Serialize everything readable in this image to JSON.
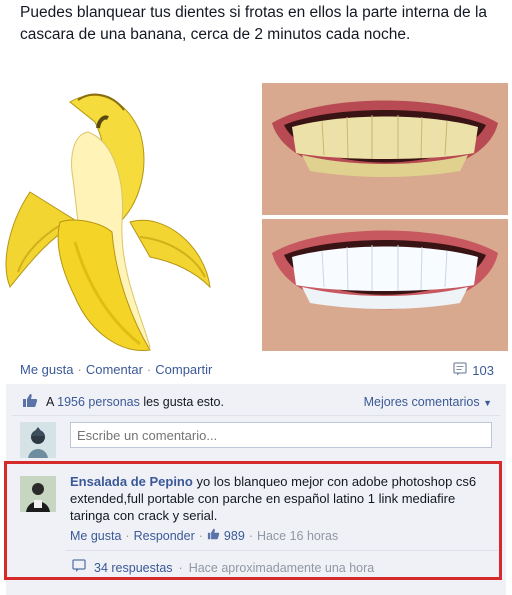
{
  "post": {
    "text": "Puedes blanquear tus dientes si frotas en ellos la parte interna de la cascara de una banana, cerca de 2 minutos cada noche."
  },
  "actions": {
    "like": "Me gusta",
    "comment": "Comentar",
    "share": "Compartir",
    "comment_count": "103"
  },
  "likes": {
    "prefix": "A",
    "people": "1956 personas",
    "suffix": "les gusta esto.",
    "sort_label": "Mejores comentarios"
  },
  "comment_input": {
    "placeholder": "Escribe un comentario..."
  },
  "top_comment": {
    "author": "Ensalada de Pepino",
    "text": "yo los blanqueo mejor con adobe photoshop cs6 extended,full portable con parche en español latino 1 link mediafire taringa con crack y serial.",
    "like_label": "Me gusta",
    "reply_label": "Responder",
    "like_count": "989",
    "time": "Hace 16 horas",
    "replies_label": "34 respuestas",
    "replies_time": "Hace aproximadamente una hora"
  },
  "colors": {
    "link": "#3b5998",
    "highlight_border": "#d62a2a",
    "ufi_background": "#eff1f6"
  },
  "icons": [
    "banana-image",
    "teeth-comparison-image",
    "comment-icon",
    "thumbs-up-icon",
    "caret-down-icon",
    "reply-icon"
  ]
}
